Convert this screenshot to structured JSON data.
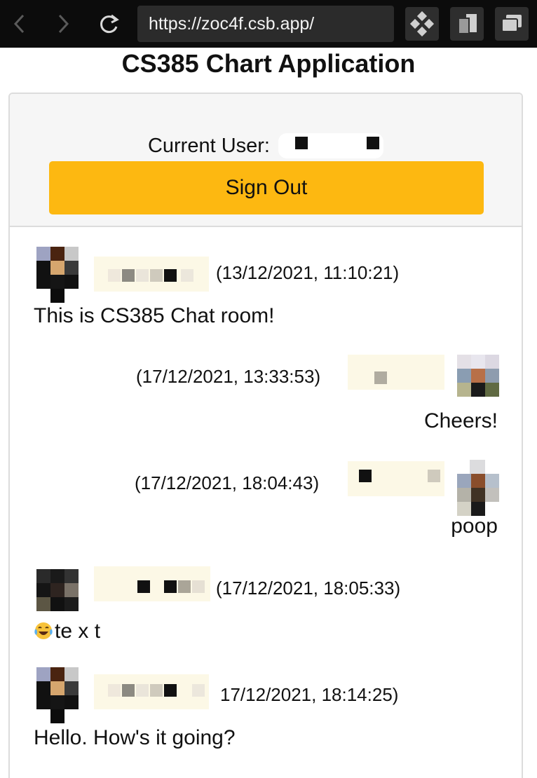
{
  "browser": {
    "url": "https://zoc4f.csb.app/",
    "icons": [
      "back-arrow-icon",
      "forward-arrow-icon",
      "reload-icon",
      "extensions-icon",
      "duplicate-tab-icon",
      "window-icon"
    ]
  },
  "app": {
    "title": "CS385 Chart Application",
    "current_user_label": "Current User:",
    "sign_out_label": "Sign Out"
  },
  "colors": {
    "accent": "#fdb811",
    "header_bg": "#f6f6f6",
    "toolbar_bg": "#0c0c0c"
  },
  "messages": [
    {
      "side": "left",
      "timestamp": "(13/12/2021, 11:10:21)",
      "text": "This is CS385 Chat room!"
    },
    {
      "side": "right",
      "timestamp": "(17/12/2021, 13:33:53)",
      "text": "Cheers!"
    },
    {
      "side": "right",
      "timestamp": "(17/12/2021, 18:04:43)",
      "text": "poop"
    },
    {
      "side": "left",
      "timestamp": "(17/12/2021, 18:05:33)",
      "text": "te x t",
      "emoji": "face-with-tears-of-joy-icon"
    },
    {
      "side": "left",
      "timestamp": "17/12/2021, 18:14:25)",
      "text": "Hello. How's it going?"
    }
  ]
}
